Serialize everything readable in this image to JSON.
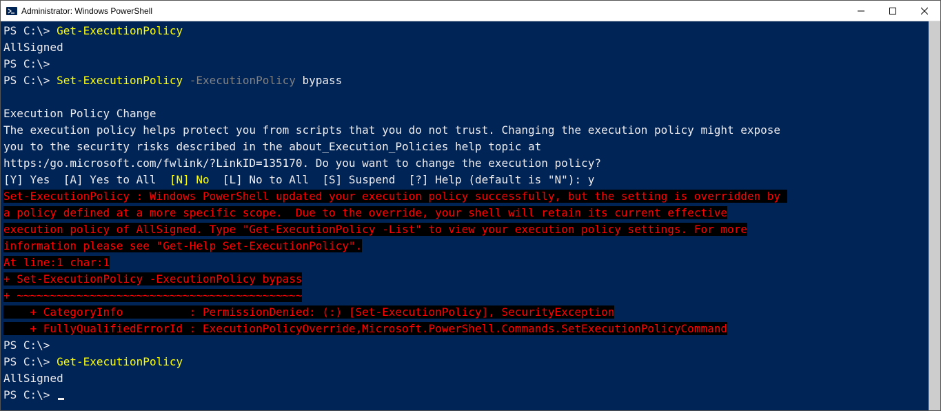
{
  "window": {
    "title": "Administrator: Windows PowerShell"
  },
  "term": {
    "prompt": "PS C:\\>",
    "cmd_get": "Get-ExecutionPolicy",
    "out_allsigned": "AllSigned",
    "cmd_set": "Set-ExecutionPolicy",
    "param_ep": "-ExecutionPolicy",
    "arg_bypass": "bypass",
    "hdr_change": "Execution Policy Change",
    "body1": "The execution policy helps protect you from scripts that you do not trust. Changing the execution policy might expose",
    "body2": "you to the security risks described in the about_Execution_Policies help topic at",
    "body3": "https:/go.microsoft.com/fwlink/?LinkID=135170. Do you want to change the execution policy?",
    "choice_y": "[Y] Yes",
    "choice_a": "[A] Yes to All",
    "choice_n": "[N] No",
    "choice_l": "[L] No to All",
    "choice_s": "[S] Suspend",
    "choice_h": "[?] Help (default is \"N\"): y",
    "err1": "Set-ExecutionPolicy : Windows PowerShell updated your execution policy successfully, but the setting is overridden by ",
    "err2": "a policy defined at a more specific scope.  Due to the override, your shell will retain its current effective",
    "err3": "execution policy of AllSigned. Type \"Get-ExecutionPolicy -List\" to view your execution policy settings. For more",
    "err4": "information please see \"Get-Help Set-ExecutionPolicy\".",
    "err5": "At line:1 char:1",
    "err6": "+ Set-ExecutionPolicy -ExecutionPolicy bypass",
    "err7": "+ ~~~~~~~~~~~~~~~~~~~~~~~~~~~~~~~~~~~~~~~~~~~",
    "err8": "    + CategoryInfo          : PermissionDenied: (:) [Set-ExecutionPolicy], SecurityException",
    "err9": "    + FullyQualifiedErrorId : ExecutionPolicyOverride,Microsoft.PowerShell.Commands.SetExecutionPolicyCommand"
  }
}
